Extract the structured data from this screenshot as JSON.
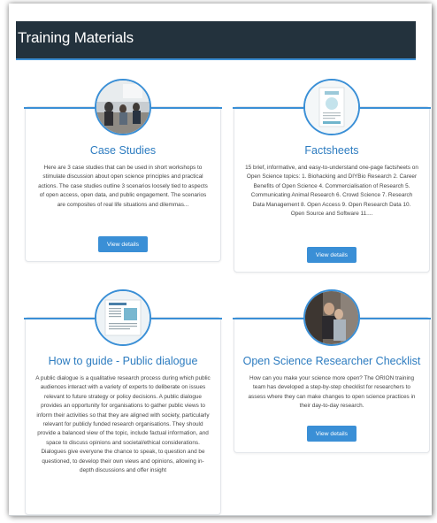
{
  "page": {
    "title": "Training Materials"
  },
  "cards": [
    {
      "title": "Case Studies",
      "description": "Here are 3 case studies that can be used in short workshops to stimulate discussion about open science principles and practical actions. The case studies outline 3 scenarios loosely tied to aspects of open access, open data, and public engagement. The scenarios are composites of real life situations and dilemmas...",
      "button": "View details",
      "icon": "workshop-photo"
    },
    {
      "title": "Factsheets",
      "description": "15 brief, informative, and easy-to-understand one-page factsheets on Open Science topics: 1. Biohacking and DIYBio Research 2. Career Benefits of Open Science 4. Commercialisation of Research 5. Communicating Animal Research 6. Crowd Science 7. Research Data Management 8. Open Access 9. Open Research Data 10. Open Source and Software 11....",
      "button": "View details",
      "icon": "factsheet-document"
    },
    {
      "title": "How to guide - Public dialogue",
      "description": "A public dialogue is a qualitative research process during which public audiences interact with a variety of experts to deliberate on issues relevant to future strategy or policy decisions. A public dialogue provides an opportunity for organisations to gather public views to inform their activities so that they are aligned with society, particularly relevant for publicly funded research organisations. They should provide a balanced view of the topic, include factual information, and space to discuss opinions and societal/ethical considerations. Dialogues give everyone the chance to speak, to question and be questioned, to develop their own views and opinions, allowing in- depth discussions and offer insight",
      "button": "",
      "icon": "guide-document"
    },
    {
      "title": "Open Science Researcher Checklist",
      "description": "How can you make your science more open? The ORION training team has developed a step-by-step checklist for researchers to assess where they can make changes to open science practices in their day-to-day research.",
      "button": "View details",
      "icon": "researcher-photo"
    }
  ]
}
